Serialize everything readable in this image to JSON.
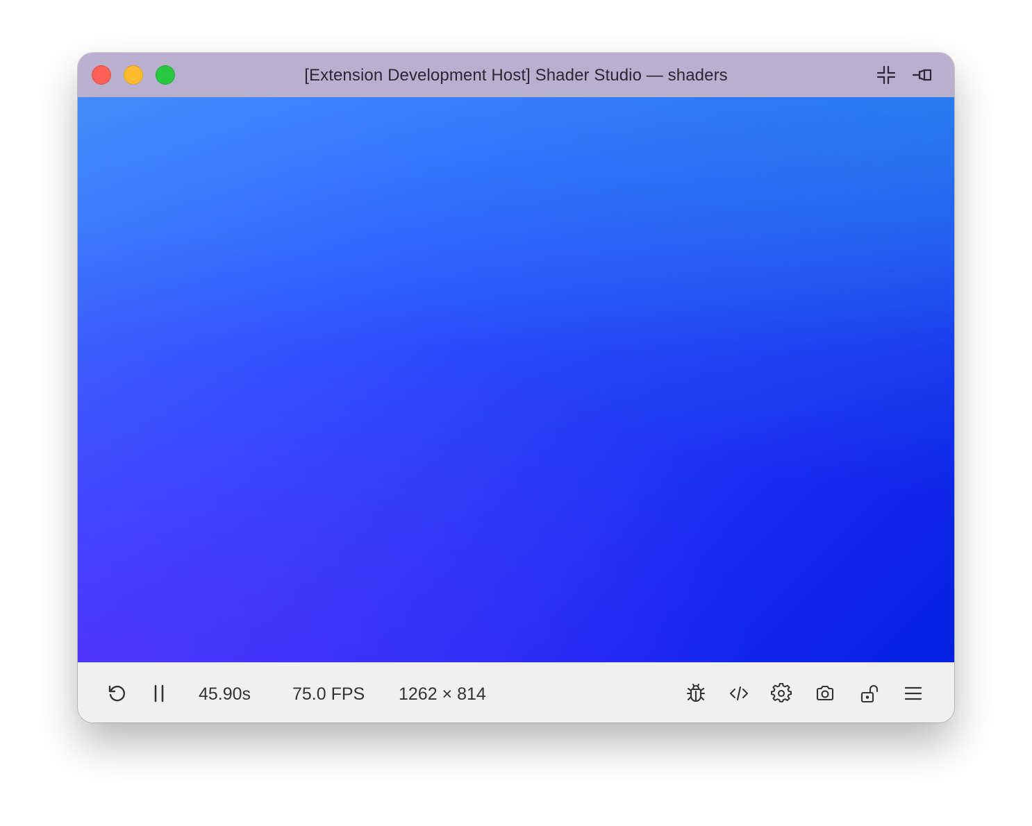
{
  "window": {
    "title": "[Extension Development Host] Shader Studio — shaders"
  },
  "titlebar": {
    "icons": [
      "collapse-icon",
      "pin-icon"
    ]
  },
  "canvas": {
    "colors": {
      "top_left": "#3d7af8",
      "top_right": "#2b86e6",
      "bottom_left": "#4a1ff0",
      "bottom_right": "#0020e0"
    }
  },
  "toolbar": {
    "time": "45.90s",
    "fps": "75.0 FPS",
    "resolution": "1262 × 814",
    "left_icons": [
      "restart-icon",
      "pause-icon"
    ],
    "right_icons": [
      "debug-icon",
      "code-icon",
      "settings-icon",
      "camera-icon",
      "unlock-icon",
      "menu-icon"
    ]
  },
  "colors": {
    "titlebar": "#b9b0cf",
    "toolbar": "#f0f0f0",
    "close": "#fe5f57",
    "minimize": "#febc2e",
    "maximize": "#28c840"
  }
}
